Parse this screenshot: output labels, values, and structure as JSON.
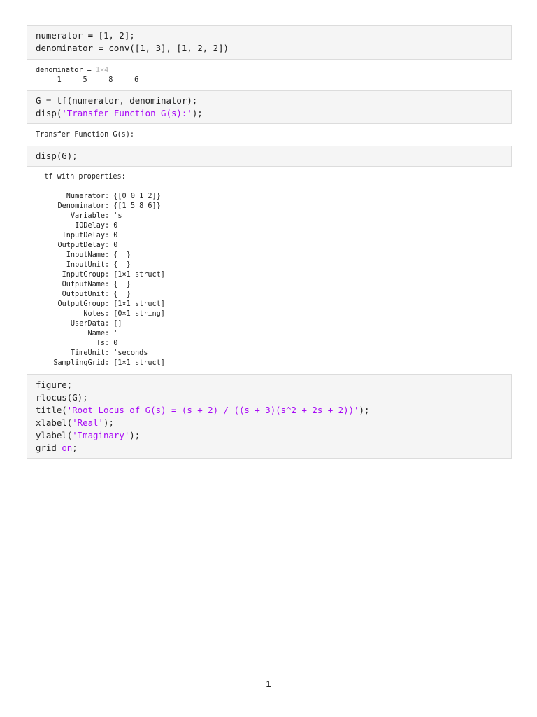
{
  "cells": [
    {
      "lines": [
        [
          {
            "t": "numerator = [1, 2];"
          }
        ],
        [
          {
            "t": "denominator = conv([1, 3], [1, 2, 2])"
          }
        ]
      ]
    },
    {
      "lines": [
        [
          {
            "t": "G = tf(numerator, denominator);"
          }
        ],
        [
          {
            "t": "disp("
          },
          {
            "t": "'Transfer Function G(s):'",
            "s": true
          },
          {
            "t": ");"
          }
        ]
      ]
    },
    {
      "lines": [
        [
          {
            "t": "disp(G);"
          }
        ]
      ]
    },
    {
      "lines": [
        [
          {
            "t": "figure;"
          }
        ],
        [
          {
            "t": "rlocus(G);"
          }
        ],
        [
          {
            "t": "title("
          },
          {
            "t": "'Root Locus of G(s) = (s + 2) / ((s + 3)(s^2 + 2s + 2))'",
            "s": true
          },
          {
            "t": ");"
          }
        ],
        [
          {
            "t": "xlabel("
          },
          {
            "t": "'Real'",
            "s": true
          },
          {
            "t": ");"
          }
        ],
        [
          {
            "t": "ylabel("
          },
          {
            "t": "'Imaginary'",
            "s": true
          },
          {
            "t": ");"
          }
        ],
        [
          {
            "t": "grid "
          },
          {
            "t": "on",
            "s": true
          },
          {
            "t": ";"
          }
        ]
      ]
    }
  ],
  "output1": {
    "label": "denominator = ",
    "size": "1×4",
    "values": "     1     5     8     6"
  },
  "output2": {
    "text": "Transfer Function G(s):"
  },
  "output3": {
    "header": "  tf with properties:",
    "props": [
      [
        "Numerator",
        "{[0 0 1 2]}"
      ],
      [
        "Denominator",
        "{[1 5 8 6]}"
      ],
      [
        "Variable",
        "'s'"
      ],
      [
        "IODelay",
        "0"
      ],
      [
        "InputDelay",
        "0"
      ],
      [
        "OutputDelay",
        "0"
      ],
      [
        "InputName",
        "{''}"
      ],
      [
        "InputUnit",
        "{''}"
      ],
      [
        "InputGroup",
        "[1×1 struct]"
      ],
      [
        "OutputName",
        "{''}"
      ],
      [
        "OutputUnit",
        "{''}"
      ],
      [
        "OutputGroup",
        "[1×1 struct]"
      ],
      [
        "Notes",
        "[0×1 string]"
      ],
      [
        "UserData",
        "[]"
      ],
      [
        "Name",
        "''"
      ],
      [
        "Ts",
        "0"
      ],
      [
        "TimeUnit",
        "'seconds'"
      ],
      [
        "SamplingGrid",
        "[1×1 struct]"
      ]
    ]
  },
  "page_number": "1"
}
